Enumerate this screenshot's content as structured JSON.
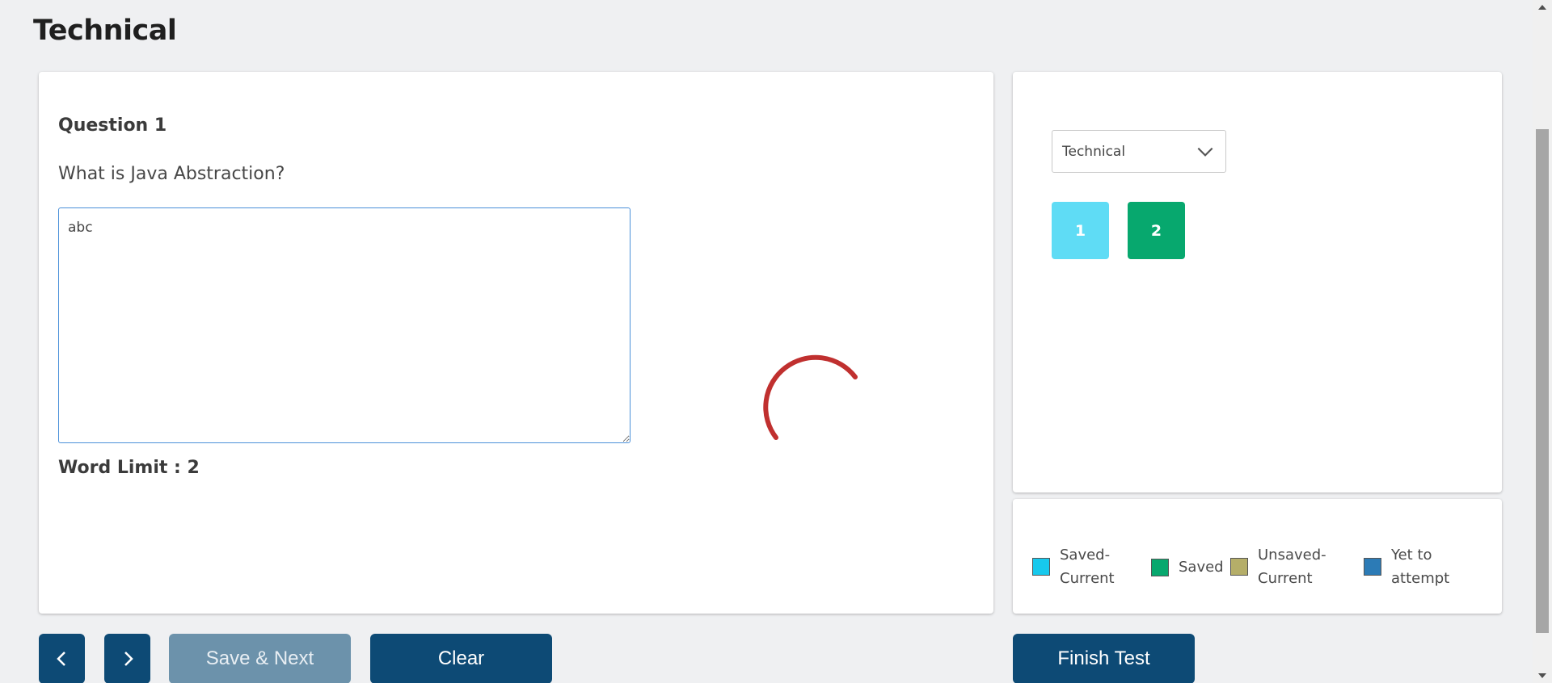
{
  "page": {
    "title": "Technical"
  },
  "question": {
    "number_label": "Question 1",
    "text": "What is Java Abstraction?",
    "answer_value": "abc",
    "word_limit_label": "Word Limit : 2"
  },
  "palette": {
    "section_selected": "Technical",
    "questions": [
      {
        "label": "1",
        "status": "saved-current",
        "color": "#5fdcf5"
      },
      {
        "label": "2",
        "status": "saved",
        "color": "#07a86e"
      }
    ]
  },
  "legend": [
    {
      "label_line1": "Saved-",
      "label_line2": "Current",
      "color": "#17c9ed"
    },
    {
      "label_line1": "Saved",
      "label_line2": "",
      "color": "#07a86e"
    },
    {
      "label_line1": "Unsaved-",
      "label_line2": "Current",
      "color": "#b5ae69"
    },
    {
      "label_line1": "Yet to",
      "label_line2": "attempt",
      "color": "#2c7bb6"
    }
  ],
  "buttons": {
    "prev_icon": "chevron-left-icon",
    "next_icon": "chevron-right-icon",
    "save_next": "Save & Next",
    "clear": "Clear",
    "finish": "Finish Test"
  },
  "colors": {
    "primary": "#0d4a75",
    "primary_disabled": "#6c92ab",
    "spinner": "#c0302f",
    "background": "#eff0f2"
  }
}
